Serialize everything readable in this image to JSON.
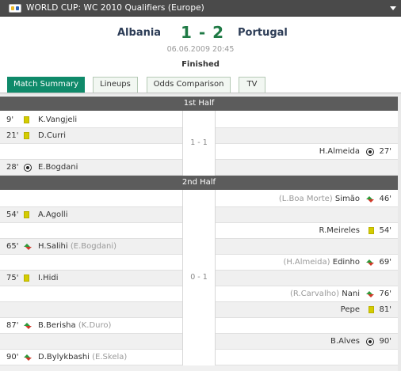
{
  "header": {
    "title": "WORLD CUP: WC 2010 Qualifiers (Europe)",
    "icon": "flag-icon"
  },
  "match": {
    "home": "Albania",
    "away": "Portugal",
    "score": "1 - 2",
    "datetime": "06.06.2009 20:45",
    "status": "Finished"
  },
  "tabs": [
    {
      "label": "Match Summary",
      "active": true
    },
    {
      "label": "Lineups",
      "active": false
    },
    {
      "label": "Odds Comparison",
      "active": false
    },
    {
      "label": "TV",
      "active": false
    }
  ],
  "halves": [
    {
      "label": "1st Half",
      "score": "1 - 1",
      "events": [
        {
          "side": "home",
          "minute": "9'",
          "type": "yellow-card",
          "player": "K.Vangjeli",
          "note": ""
        },
        {
          "side": "home",
          "minute": "21'",
          "type": "yellow-card",
          "player": "D.Curri",
          "note": ""
        },
        {
          "side": "away",
          "minute": "27'",
          "type": "goal",
          "player": "H.Almeida",
          "note": ""
        },
        {
          "side": "home",
          "minute": "28'",
          "type": "goal",
          "player": "E.Bogdani",
          "note": ""
        }
      ]
    },
    {
      "label": "2nd Half",
      "score": "0 - 1",
      "events": [
        {
          "side": "away",
          "minute": "46'",
          "type": "substitution",
          "player": "Simão",
          "note": "(L.Boa Morte)"
        },
        {
          "side": "home",
          "minute": "54'",
          "type": "yellow-card",
          "player": "A.Agolli",
          "note": ""
        },
        {
          "side": "away",
          "minute": "54'",
          "type": "yellow-card",
          "player": "R.Meireles",
          "note": ""
        },
        {
          "side": "home",
          "minute": "65'",
          "type": "substitution",
          "player": "H.Salihi",
          "note": "(E.Bogdani)"
        },
        {
          "side": "away",
          "minute": "69'",
          "type": "substitution",
          "player": "Edinho",
          "note": "(H.Almeida)"
        },
        {
          "side": "home",
          "minute": "75'",
          "type": "yellow-card",
          "player": "I.Hidi",
          "note": ""
        },
        {
          "side": "away",
          "minute": "76'",
          "type": "substitution",
          "player": "Nani",
          "note": "(R.Carvalho)"
        },
        {
          "side": "away",
          "minute": "81'",
          "type": "yellow-card",
          "player": "Pepe",
          "note": ""
        },
        {
          "side": "home",
          "minute": "87'",
          "type": "substitution",
          "player": "B.Berisha",
          "note": "(K.Duro)"
        },
        {
          "side": "away",
          "minute": "90'",
          "type": "goal",
          "player": "B.Alves",
          "note": ""
        },
        {
          "side": "home",
          "minute": "90'",
          "type": "substitution",
          "player": "D.Bylykbashi",
          "note": "(E.Skela)"
        }
      ]
    }
  ],
  "colors": {
    "accent": "#0f8a6a",
    "score": "#1f7a45",
    "header_bg": "#4a4a4a",
    "half_bg": "#5c5c5c"
  }
}
